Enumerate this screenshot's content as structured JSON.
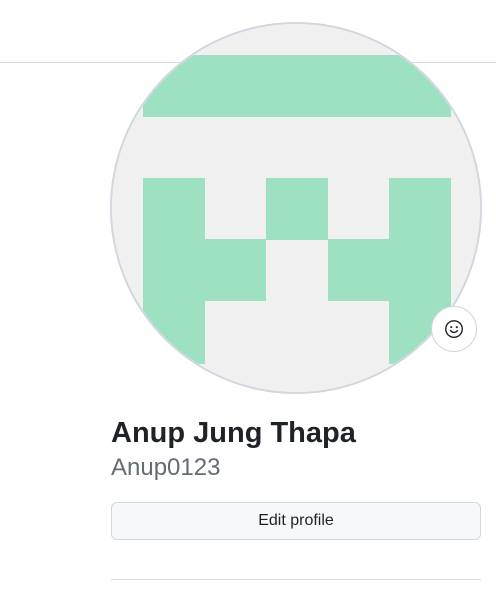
{
  "profile": {
    "full_name": "Anup Jung Thapa",
    "username": "Anup0123",
    "edit_button_label": "Edit profile"
  },
  "avatar": {
    "type": "identicon",
    "foreground_color": "#9de0c2",
    "background_color": "#f0f0f0"
  },
  "status": {
    "icon": "smiley-icon"
  }
}
